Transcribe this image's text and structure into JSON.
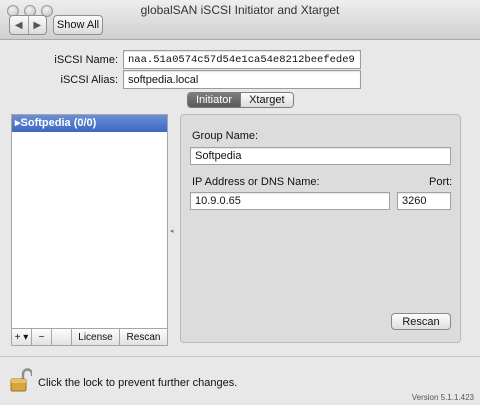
{
  "window": {
    "title": "globalSAN iSCSI Initiator and Xtarget"
  },
  "toolbar": {
    "back_glyph": "◀",
    "forward_glyph": "▶",
    "show_all_label": "Show All"
  },
  "fields": {
    "iscsi_name_label": "iSCSI Name:",
    "iscsi_name_value": "naa.51a0574c57d54e1ca54e8212beefede9",
    "iscsi_alias_label": "iSCSI Alias:",
    "iscsi_alias_value": "softpedia.local"
  },
  "tabs": [
    {
      "label": "Initiator",
      "active": true
    },
    {
      "label": "Xtarget",
      "active": false
    }
  ],
  "sidebar": {
    "items": [
      {
        "label": "▸Softpedia (0/0)",
        "selected": true
      }
    ],
    "toolbar": {
      "add_label": "+ ▾",
      "remove_label": "−",
      "license_label": "License",
      "rescan_label": "Rescan"
    }
  },
  "detail": {
    "group_name_label": "Group Name:",
    "group_name_value": "Softpedia",
    "address_label": "IP Address or DNS Name:",
    "address_value": "10.9.0.65",
    "port_label": "Port:",
    "port_value": "3260",
    "rescan_label": "Rescan"
  },
  "footer": {
    "lock_text": "Click the lock to prevent further changes.",
    "version": "Version 5.1.1.423"
  },
  "colors": {
    "selection": "#3d66c1",
    "active_tab": "#5a5a5a"
  }
}
